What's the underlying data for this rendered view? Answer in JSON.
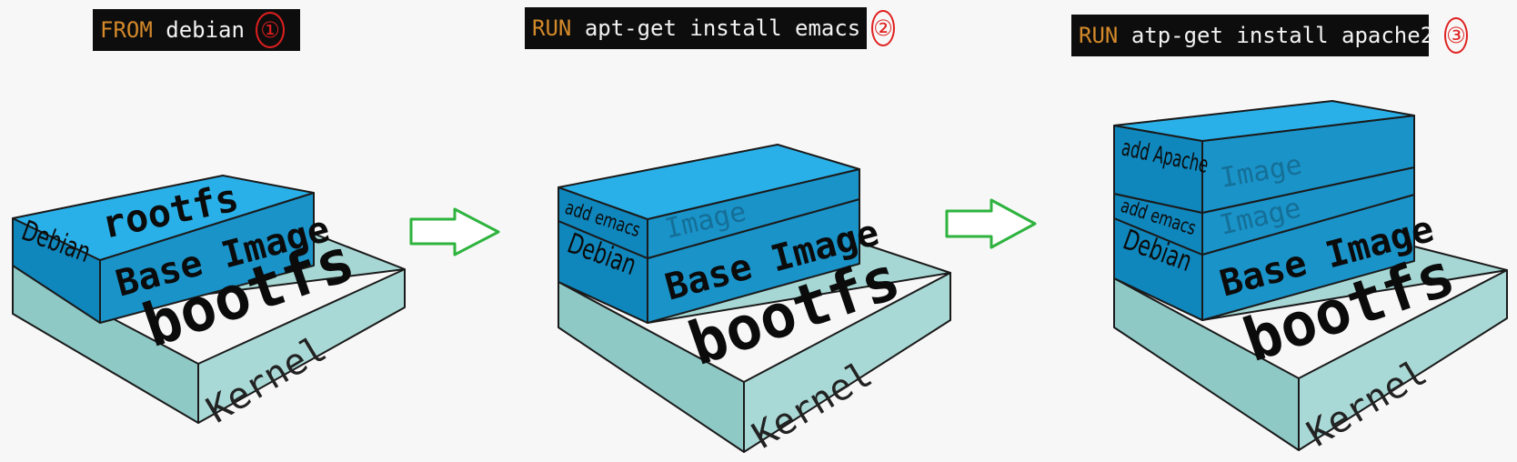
{
  "steps": [
    {
      "keyword": "FROM",
      "command": "debian",
      "number": "①",
      "layers": {
        "kernel": "Kernel",
        "bootfs": "bootfs",
        "base": "Base Image",
        "debian": "Debian",
        "rootfs": "rootfs"
      }
    },
    {
      "keyword": "RUN",
      "command": "apt-get install emacs",
      "number": "②",
      "layers": {
        "kernel": "Kernel",
        "bootfs": "bootfs",
        "base": "Base Image",
        "debian": "Debian",
        "image": "Image",
        "add": "add emacs"
      }
    },
    {
      "keyword": "RUN",
      "command": "atp-get install apache2",
      "number": "③",
      "layers": {
        "kernel": "Kernel",
        "bootfs": "bootfs",
        "base": "Base Image",
        "debian": "Debian",
        "image1": "Image",
        "add1": "add emacs",
        "image2": "Image",
        "add2": "add Apache"
      }
    }
  ],
  "colors": {
    "kernel_top": "#a6d7d4",
    "kernel_side": "#8fc9c6",
    "layer_front": "#1a93c9",
    "layer_side": "#0f86bc",
    "layer_top": "#2ab0e8",
    "arrow": "#2eb33e",
    "command_bg": "#0d0d0d",
    "keyword": "#d4892a",
    "number": "#e01f1f"
  }
}
